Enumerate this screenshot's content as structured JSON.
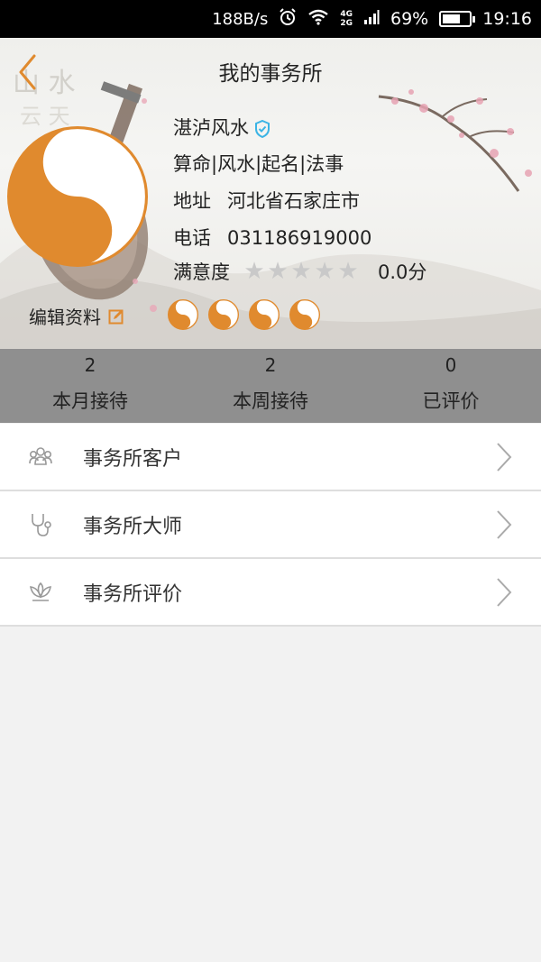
{
  "status_bar": {
    "net_speed": "188B/s",
    "network_type_top": "4G",
    "network_type_bottom": "2G",
    "battery_percent": "69%",
    "battery_level": 0.69,
    "time": "19:16"
  },
  "header": {
    "title": "我的事务所",
    "shop_name": "湛泸风水",
    "services": "算命|风水|起名|法事",
    "address_label": "地址",
    "address_value": "河北省石家庄市",
    "phone_label": "电话",
    "phone_value": "031186919000",
    "rating_label": "满意度",
    "rating_stars": 0,
    "rating_max": 5,
    "rating_score": "0.0分",
    "edit_label": "编辑资料",
    "badge_count": 4,
    "colors": {
      "accent": "#e08a2e",
      "verified": "#3bb4e5",
      "star_empty": "#c9c9c9"
    }
  },
  "stats": [
    {
      "value": "2",
      "label": "本月接待"
    },
    {
      "value": "2",
      "label": "本周接待"
    },
    {
      "value": "0",
      "label": "已评价"
    }
  ],
  "menu": [
    {
      "label": "事务所客户",
      "icon": "group-icon"
    },
    {
      "label": "事务所大师",
      "icon": "stethoscope-icon"
    },
    {
      "label": "事务所评价",
      "icon": "lotus-icon"
    }
  ]
}
